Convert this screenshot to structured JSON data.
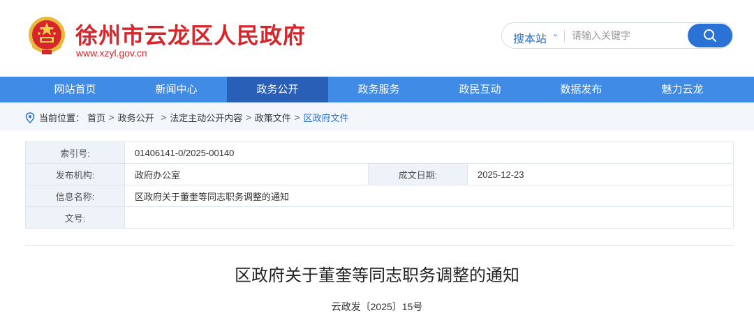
{
  "header": {
    "site_title": "徐州市云龙区人民政府",
    "site_url": "www.xzyl.gov.cn",
    "brand_color": "#d6262c"
  },
  "search": {
    "scope_label": "搜本站",
    "placeholder": "请输入关键字",
    "button_icon": "search-icon"
  },
  "nav": {
    "items": [
      {
        "label": "网站首页"
      },
      {
        "label": "新闻中心"
      },
      {
        "label": "政务公开",
        "active": true
      },
      {
        "label": "政务服务"
      },
      {
        "label": "政民互动"
      },
      {
        "label": "数据发布"
      },
      {
        "label": "魅力云龙"
      }
    ],
    "bar_color": "#3f8be6",
    "active_color": "#2a5fb8"
  },
  "breadcrumb": {
    "prefix": "当前位置：",
    "items": [
      "首页",
      "政务公开",
      "法定主动公开内容",
      "政策文件",
      "区政府文件"
    ]
  },
  "meta": {
    "index_label": "索引号:",
    "index_value": "01406141-0/2025-00140",
    "publisher_label": "发布机构:",
    "publisher_value": "政府办公室",
    "date_label": "成文日期:",
    "date_value": "2025-12-23",
    "info_label": "信息名称:",
    "info_value": "区政府关于董奎等同志职务调整的通知",
    "docno_label": "文号:",
    "docno_value": ""
  },
  "document": {
    "title": "区政府关于董奎等同志职务调整的通知",
    "number": "云政发〔2025〕15号"
  }
}
